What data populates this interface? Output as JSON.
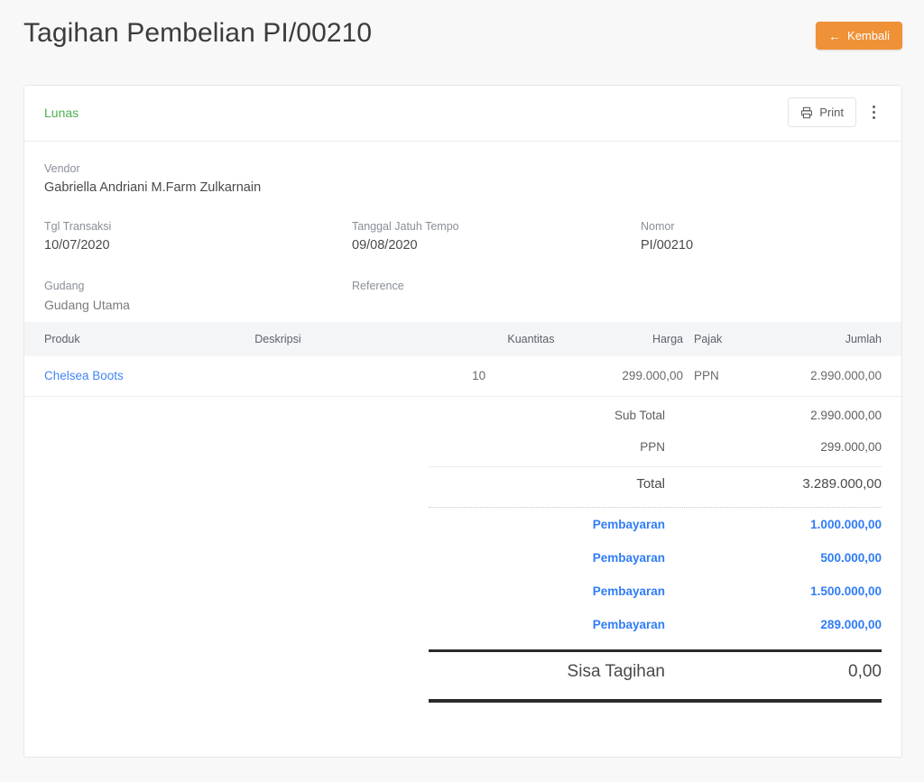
{
  "header": {
    "title": "Tagihan Pembelian PI/00210",
    "back_label": "Kembali",
    "back_icon": "arrow-left-icon",
    "accent_color": "#ef9136"
  },
  "card": {
    "status": "Lunas",
    "status_color": "#4caf50",
    "print_label": "Print",
    "print_icon": "printer-icon",
    "more_icon": "kebab-menu-icon"
  },
  "info": {
    "vendor_label": "Vendor",
    "vendor_name": "Gabriella Andriani M.Farm Zulkarnain",
    "tgl_transaksi_label": "Tgl Transaksi",
    "tgl_transaksi_value": "10/07/2020",
    "jatuh_tempo_label": "Tanggal Jatuh Tempo",
    "jatuh_tempo_value": "09/08/2020",
    "nomor_label": "Nomor",
    "nomor_value": "PI/00210",
    "gudang_label": "Gudang",
    "gudang_value": "Gudang Utama",
    "reference_label": "Reference",
    "reference_value": ""
  },
  "table": {
    "columns": [
      "Produk",
      "Deskripsi",
      "Kuantitas",
      "Harga",
      "Pajak",
      "Jumlah"
    ],
    "rows": [
      {
        "produk": "Chelsea Boots",
        "deskripsi": "",
        "kuantitas": "10",
        "harga": "299.000,00",
        "pajak": "PPN",
        "jumlah": "2.990.000,00"
      }
    ]
  },
  "totals": {
    "sub_total_label": "Sub Total",
    "sub_total_value": "2.990.000,00",
    "ppn_label": "PPN",
    "ppn_value": "299.000,00",
    "total_label": "Total",
    "total_value": "3.289.000,00",
    "payments": [
      {
        "label": "Pembayaran",
        "value": "1.000.000,00"
      },
      {
        "label": "Pembayaran",
        "value": "500.000,00"
      },
      {
        "label": "Pembayaran",
        "value": "1.500.000,00"
      },
      {
        "label": "Pembayaran",
        "value": "289.000,00"
      }
    ],
    "payment_color": "#2f7cf6",
    "sisa_label": "Sisa Tagihan",
    "sisa_value": "0,00"
  }
}
